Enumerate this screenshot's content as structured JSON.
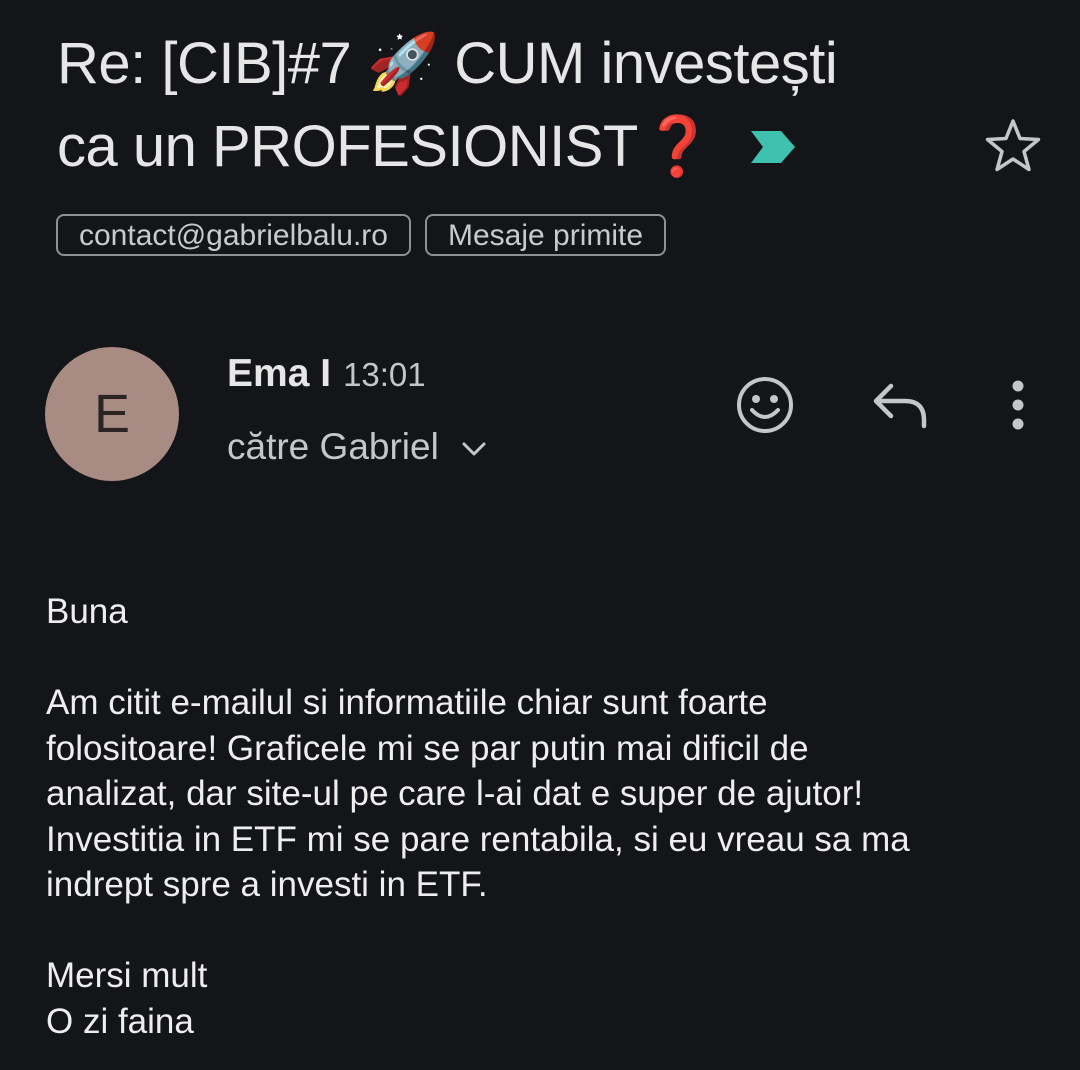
{
  "email": {
    "subject_prefix": "Re: [CIB]#7",
    "subject_emoji": "🚀",
    "subject_line1_rest": "CUM investești",
    "subject_line2": "ca un PROFESIONIST",
    "subject_question_mark": "❓",
    "labels": [
      "contact@gabrielbalu.ro",
      "Mesaje primite"
    ],
    "important_marker_color": "#3fc1b0",
    "starred": false
  },
  "message": {
    "avatar_letter": "E",
    "avatar_color": "#a88c84",
    "sender_name": "Ema I",
    "time": "13:01",
    "recipient": "către Gabriel",
    "greeting": "Buna",
    "paragraph_lines": [
      "Am citit e-mailul si informatiile chiar sunt foarte",
      "folositoare! Graficele mi se par putin mai dificil de",
      "analizat, dar site-ul pe care l-ai dat e super de ajutor!",
      "Investitia in ETF mi se pare rentabila, si eu vreau sa ma",
      "indrept spre a investi in ETF."
    ],
    "closing": [
      "Mersi mult",
      "O zi faina"
    ]
  },
  "icons": {
    "star": "star-outline-icon",
    "important": "important-marker-icon",
    "emoji": "emoji-reaction-icon",
    "reply": "reply-icon",
    "more": "more-vertical-icon",
    "expand": "chevron-down-icon"
  }
}
